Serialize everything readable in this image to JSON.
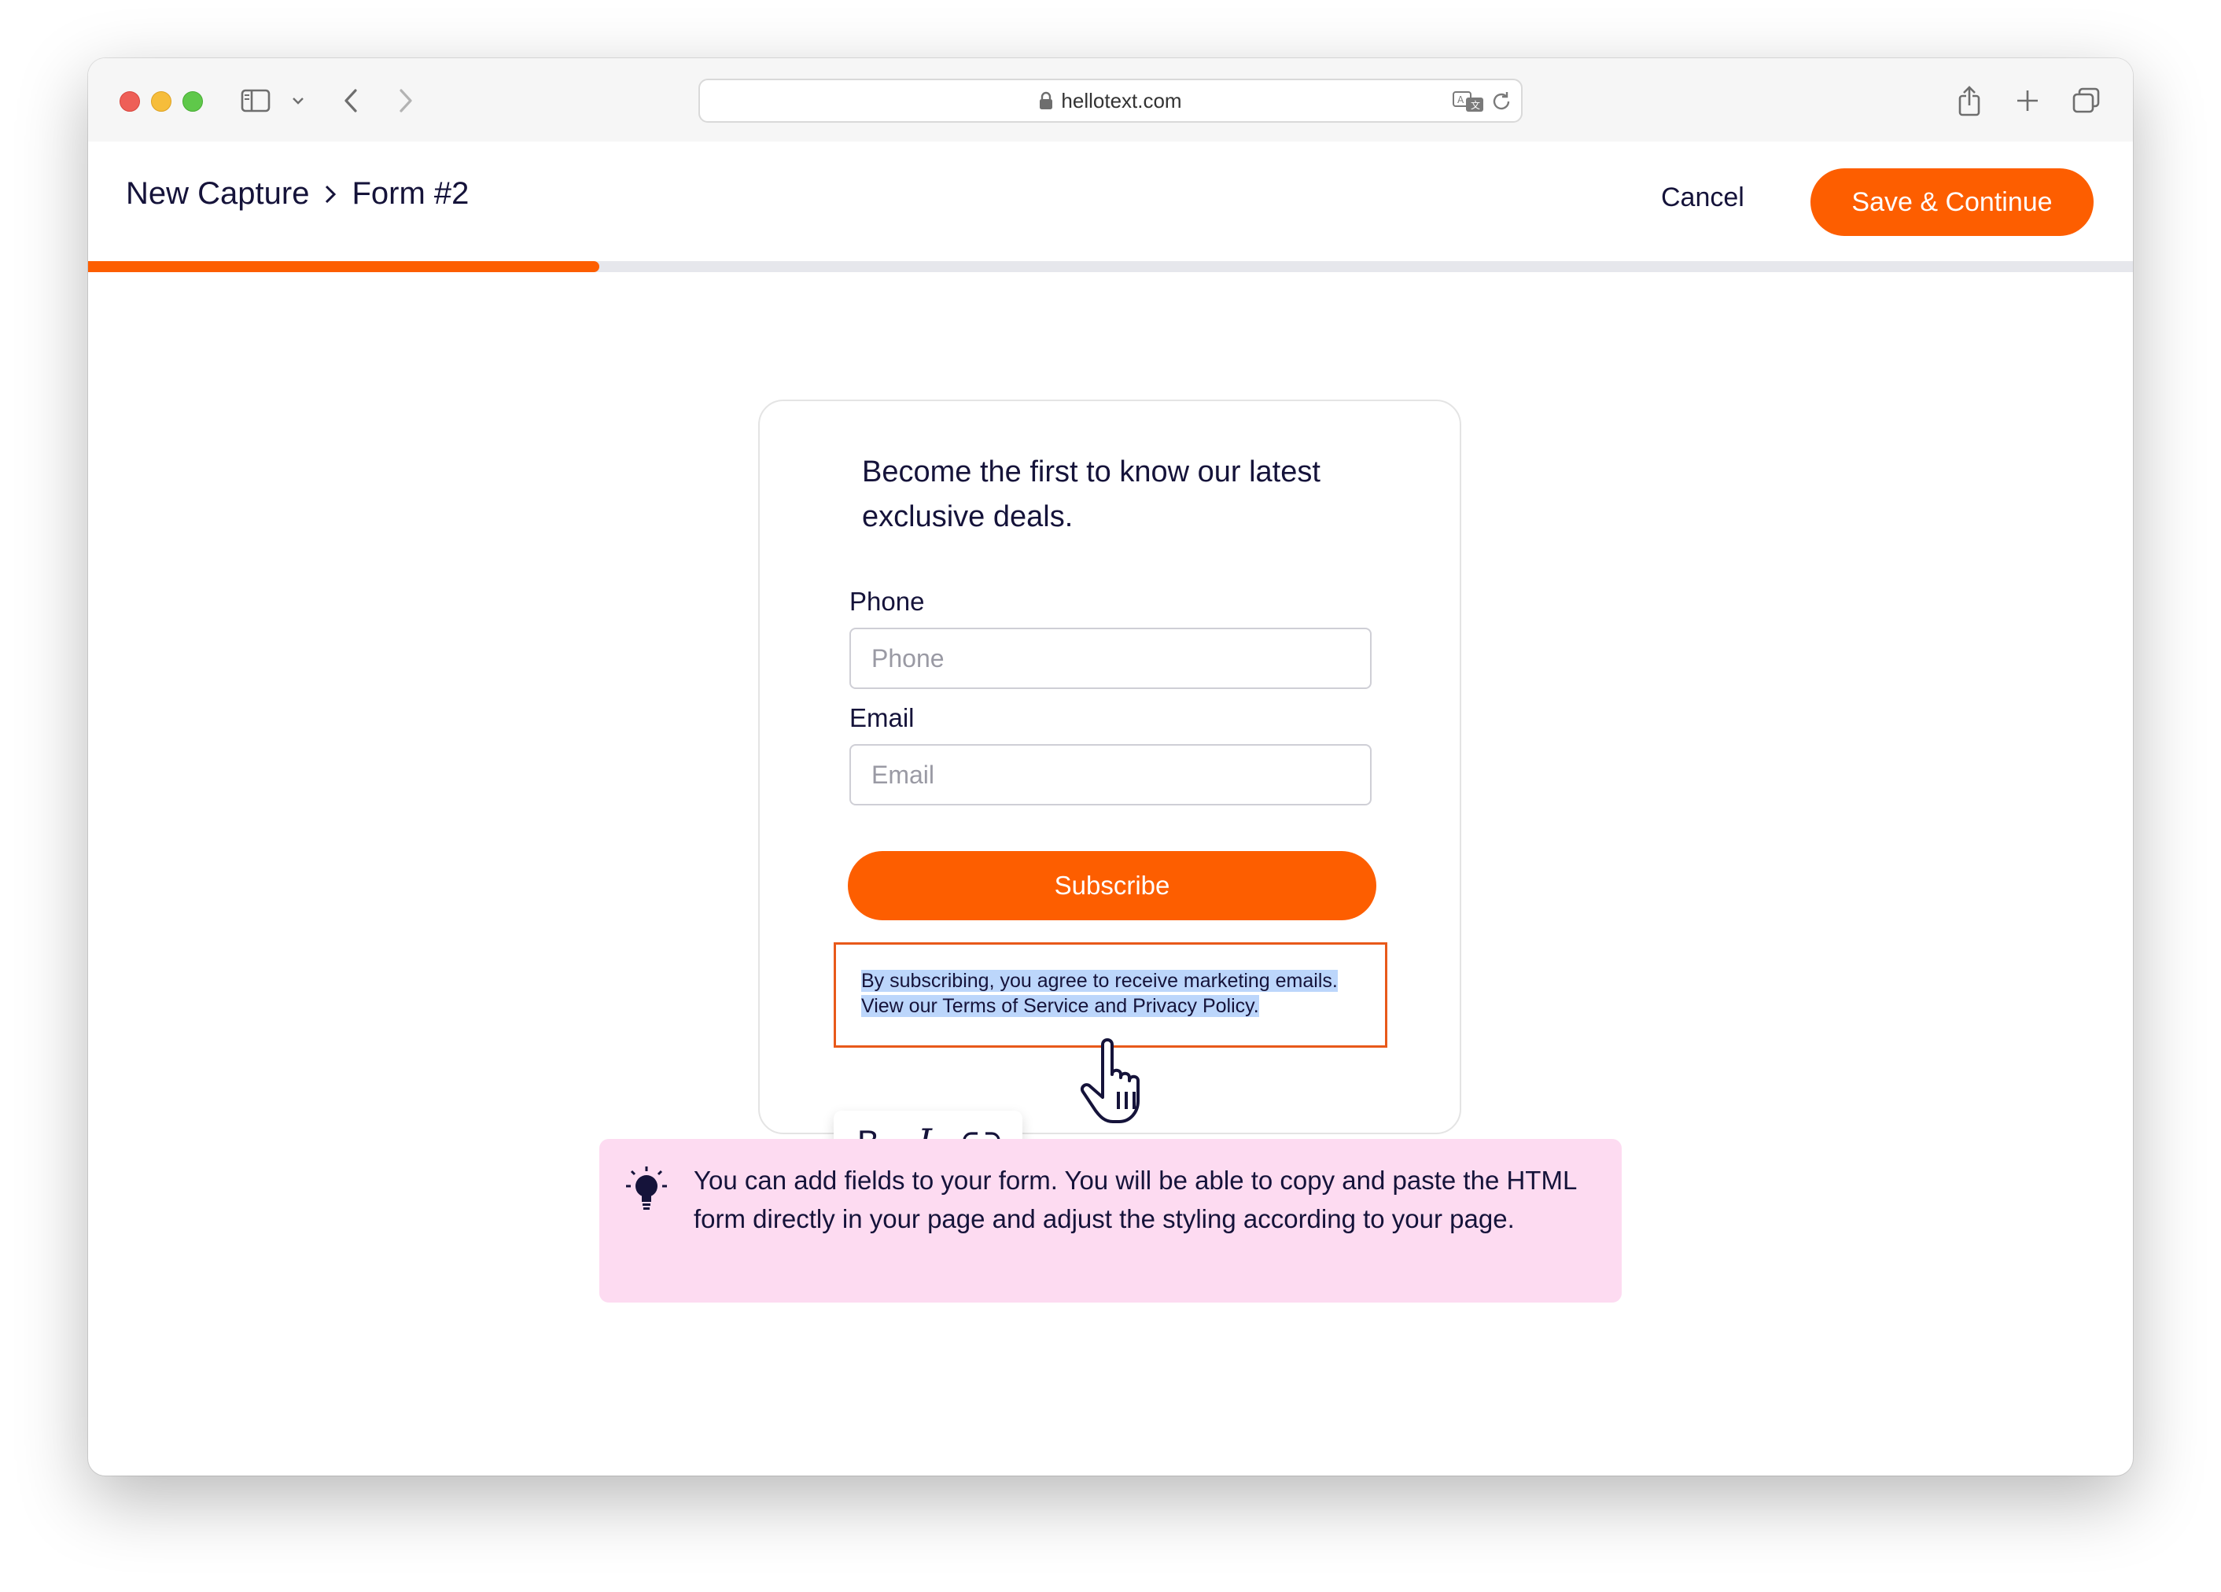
{
  "browser": {
    "url": "hellotext.com"
  },
  "header": {
    "breadcrumb": [
      "New Capture",
      "Form #2"
    ],
    "cancel_label": "Cancel",
    "save_label": "Save & Continue",
    "progress_fraction": 0.25
  },
  "form": {
    "heading": "Become the first to know our latest exclusive deals.",
    "fields": [
      {
        "label": "Phone",
        "placeholder": "Phone"
      },
      {
        "label": "Email",
        "placeholder": "Email"
      }
    ],
    "submit_label": "Subscribe",
    "disclaimer": "By subscribing, you agree to receive marketing emails. View our Terms of Service and Privacy Policy."
  },
  "format_toolbar": {
    "bold": "B",
    "italic": "I",
    "link_icon": "link-icon"
  },
  "tip": {
    "icon": "lightbulb-icon",
    "text": "You can add fields to your form. You will be able to copy and paste the HTML form directly in your page and adjust the styling according to your page."
  },
  "colors": {
    "accent": "#fd5e00",
    "text": "#15133a",
    "tip_bg": "#fddbf1",
    "selection": "#bcd6fb"
  }
}
